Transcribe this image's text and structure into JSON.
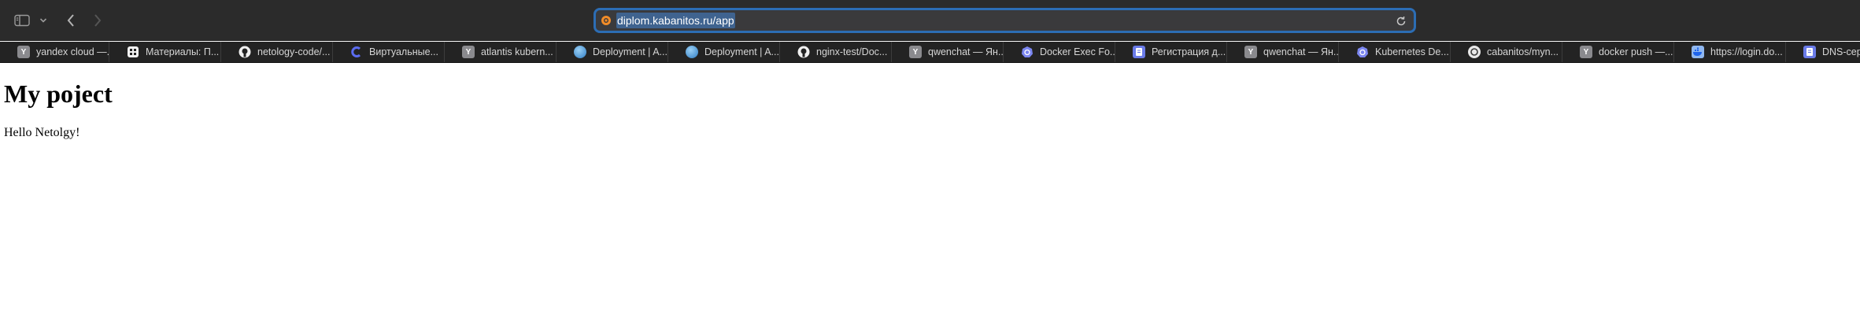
{
  "addressbar": {
    "url": "diplom.kabanitos.ru/app"
  },
  "bookmarks": [
    {
      "label": "yandex cloud —...",
      "icon": "yandex-icon"
    },
    {
      "label": "Материалы: П...",
      "icon": "materials-icon"
    },
    {
      "label": "netology-code/...",
      "icon": "github-icon"
    },
    {
      "label": "Виртуальные...",
      "icon": "c-logo-icon"
    },
    {
      "label": "atlantis kubern...",
      "icon": "yandex-icon"
    },
    {
      "label": "Deployment | A...",
      "icon": "globe-icon"
    },
    {
      "label": "Deployment | A...",
      "icon": "globe-icon"
    },
    {
      "label": "nginx-test/Doc...",
      "icon": "github-icon"
    },
    {
      "label": "qwenchat — Ян...",
      "icon": "yandex-icon"
    },
    {
      "label": "Docker Exec Fo...",
      "icon": "kubernetes-icon"
    },
    {
      "label": "Регистрация д...",
      "icon": "document-icon"
    },
    {
      "label": "qwenchat — Ян...",
      "icon": "yandex-icon"
    },
    {
      "label": "Kubernetes De...",
      "icon": "kubernetes-icon"
    },
    {
      "label": "cabanitos/myn...",
      "icon": "cabanitos-icon"
    },
    {
      "label": "docker push —...",
      "icon": "yandex-icon"
    },
    {
      "label": "https://login.do...",
      "icon": "docker-icon"
    },
    {
      "label": "DNS-cep",
      "icon": "document-icon"
    }
  ],
  "page": {
    "heading": "My poject",
    "text": "Hello Netolgy!"
  },
  "colors": {
    "toolbar": "#2b2b2b",
    "url_focus": "#2c6db4",
    "bookmarks_bar": "#232323"
  }
}
